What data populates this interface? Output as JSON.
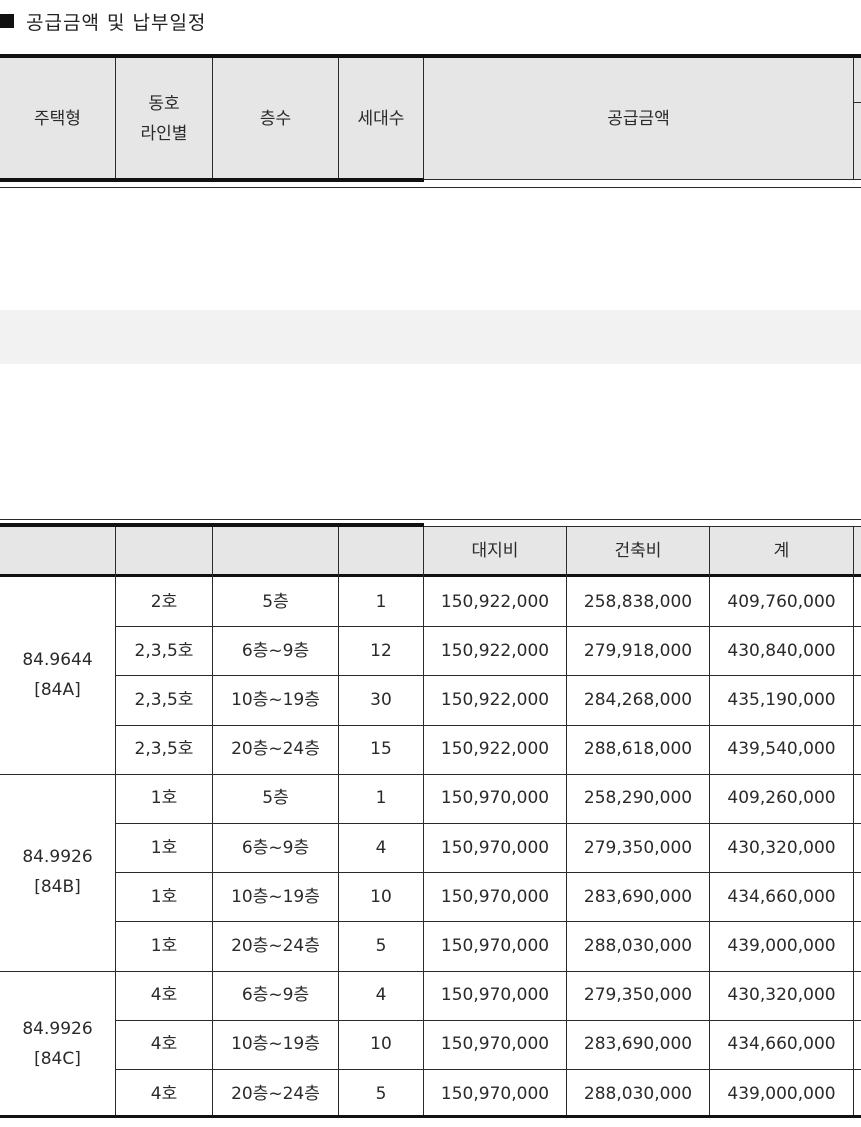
{
  "section_title": "공급금액 및 납부일정",
  "header": {
    "type": "주택형",
    "line_1": "동호",
    "line_2": "라인별",
    "floor": "층수",
    "households": "세대수",
    "price": "공급금액"
  },
  "subheader": {
    "land": "대지비",
    "building": "건축비",
    "total": "계"
  },
  "groups": [
    {
      "type_1": "84.9644",
      "type_2": "[84A]",
      "rows": [
        {
          "line": "2호",
          "floor": "5층",
          "households": "1",
          "land": "150,922,000",
          "building": "258,838,000",
          "total": "409,760,000"
        },
        {
          "line": "2,3,5호",
          "floor": "6층~9층",
          "households": "12",
          "land": "150,922,000",
          "building": "279,918,000",
          "total": "430,840,000"
        },
        {
          "line": "2,3,5호",
          "floor": "10층~19층",
          "households": "30",
          "land": "150,922,000",
          "building": "284,268,000",
          "total": "435,190,000"
        },
        {
          "line": "2,3,5호",
          "floor": "20층~24층",
          "households": "15",
          "land": "150,922,000",
          "building": "288,618,000",
          "total": "439,540,000"
        }
      ]
    },
    {
      "type_1": "84.9926",
      "type_2": "[84B]",
      "rows": [
        {
          "line": "1호",
          "floor": "5층",
          "households": "1",
          "land": "150,970,000",
          "building": "258,290,000",
          "total": "409,260,000"
        },
        {
          "line": "1호",
          "floor": "6층~9층",
          "households": "4",
          "land": "150,970,000",
          "building": "279,350,000",
          "total": "430,320,000"
        },
        {
          "line": "1호",
          "floor": "10층~19층",
          "households": "10",
          "land": "150,970,000",
          "building": "283,690,000",
          "total": "434,660,000"
        },
        {
          "line": "1호",
          "floor": "20층~24층",
          "households": "5",
          "land": "150,970,000",
          "building": "288,030,000",
          "total": "439,000,000"
        }
      ]
    },
    {
      "type_1": "84.9926",
      "type_2": "[84C]",
      "rows": [
        {
          "line": "4호",
          "floor": "6층~9층",
          "households": "4",
          "land": "150,970,000",
          "building": "279,350,000",
          "total": "430,320,000"
        },
        {
          "line": "4호",
          "floor": "10층~19층",
          "households": "10",
          "land": "150,970,000",
          "building": "283,690,000",
          "total": "434,660,000"
        },
        {
          "line": "4호",
          "floor": "20층~24층",
          "households": "5",
          "land": "150,970,000",
          "building": "288,030,000",
          "total": "439,000,000"
        }
      ]
    }
  ]
}
